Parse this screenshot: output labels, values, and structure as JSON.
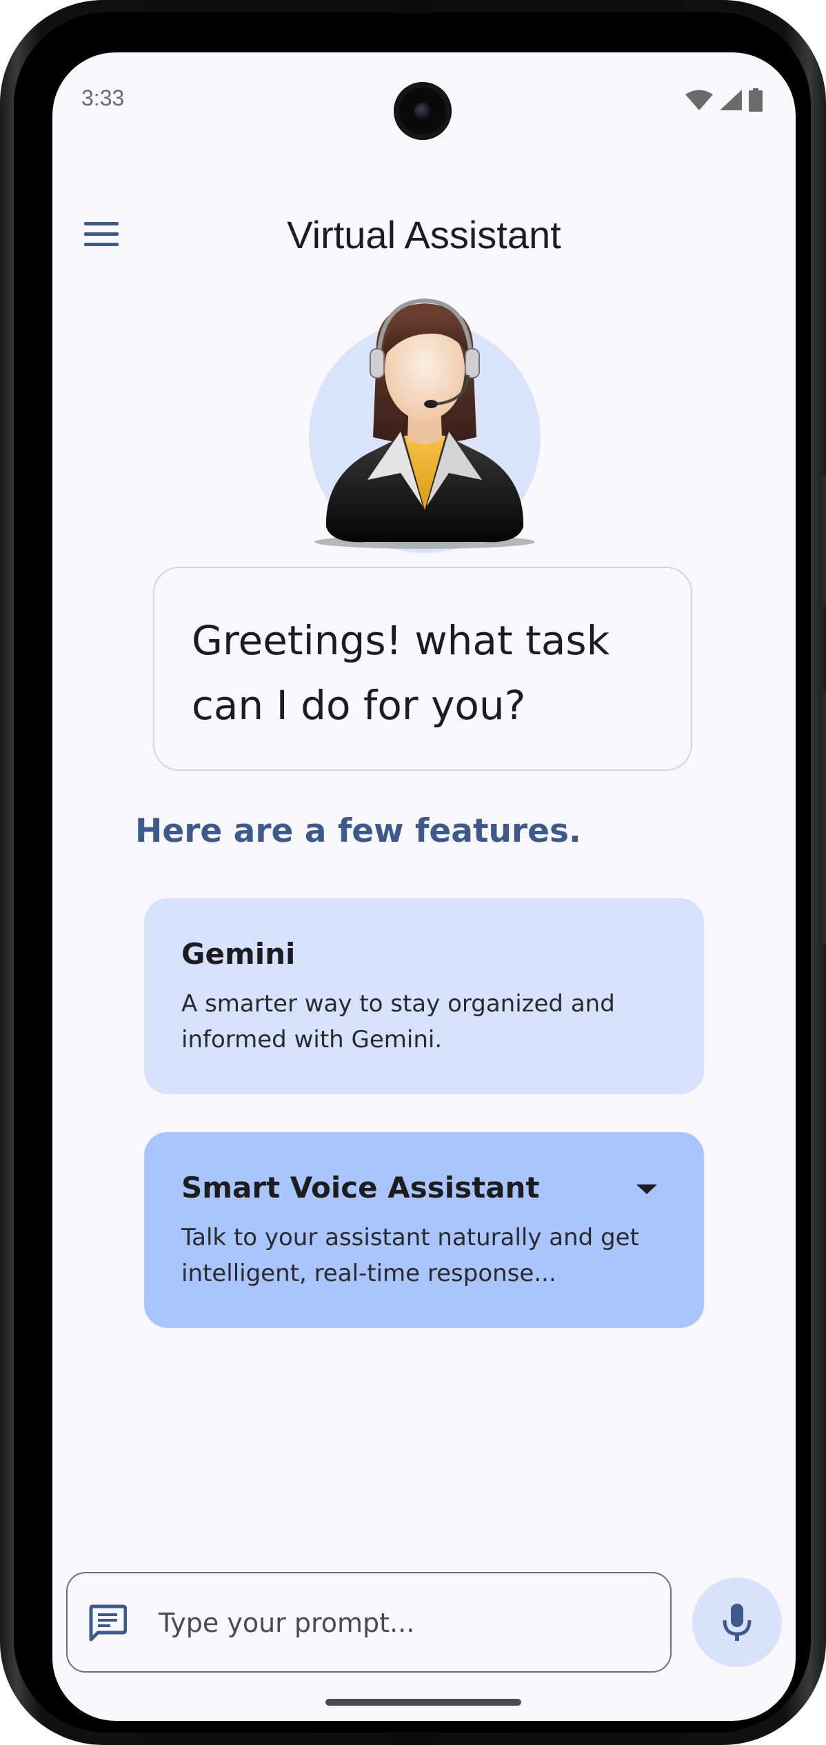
{
  "status_bar": {
    "time": "3:33",
    "icons": [
      "wifi-icon",
      "cellular-signal-icon",
      "battery-icon"
    ]
  },
  "app_bar": {
    "title": "Virtual Assistant",
    "menu_icon": "menu-icon"
  },
  "assistant": {
    "avatar_icon": "assistant-avatar",
    "greeting": "Greetings! what task can I do for you?"
  },
  "features": {
    "heading": "Here are a few features.",
    "items": [
      {
        "title": "Gemini",
        "description": "A smarter way to stay organized and informed with Gemini."
      },
      {
        "title": "Smart Voice Assistant",
        "description": "Talk to your assistant naturally and get intelligent, real-time response...",
        "icon": "dropdown-arrow-icon"
      }
    ]
  },
  "input_bar": {
    "placeholder": "Type your prompt...",
    "prompt_icon": "chat-icon",
    "mic_icon": "microphone-icon"
  },
  "colors": {
    "background": "#f8f7fc",
    "accent": "#3d5a8a",
    "card_light": "#d6e2fc",
    "card_selected": "#a9c5fb",
    "mic_button": "#d8e3fb"
  }
}
